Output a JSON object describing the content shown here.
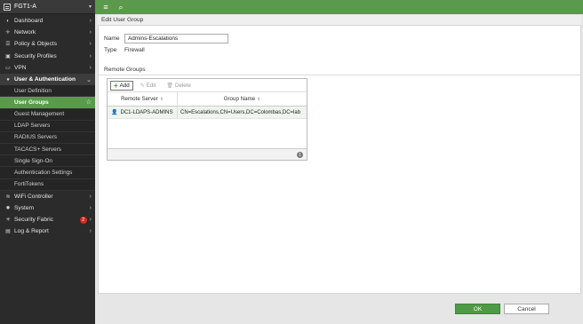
{
  "device": {
    "name": "FGT1-A"
  },
  "sidebar": {
    "items": [
      {
        "icon": "dashboard-icon",
        "glyph": "◐",
        "label": "Dashboard",
        "chevron": "›"
      },
      {
        "icon": "network-icon",
        "glyph": "✛",
        "label": "Network",
        "chevron": "›"
      },
      {
        "icon": "policy-icon",
        "glyph": "☰",
        "label": "Policy & Objects",
        "chevron": "›"
      },
      {
        "icon": "lock-icon",
        "glyph": "▣",
        "label": "Security Profiles",
        "chevron": "›"
      },
      {
        "icon": "vpn-icon",
        "glyph": "▭",
        "label": "VPN",
        "chevron": "›"
      },
      {
        "icon": "user-icon",
        "glyph": "●",
        "label": "User & Authentication",
        "chevron": "⌄"
      }
    ],
    "subitems": [
      {
        "label": "User Definition"
      },
      {
        "label": "User Groups"
      },
      {
        "label": "Guest Management"
      },
      {
        "label": "LDAP Servers"
      },
      {
        "label": "RADIUS Servers"
      },
      {
        "label": "TACACS+ Servers"
      },
      {
        "label": "Single Sign-On"
      },
      {
        "label": "Authentication Settings"
      },
      {
        "label": "FortiTokens"
      }
    ],
    "lower": [
      {
        "icon": "wifi-icon",
        "glyph": "≋",
        "label": "WiFi Controller",
        "chevron": "›"
      },
      {
        "icon": "gear-icon",
        "glyph": "✹",
        "label": "System",
        "chevron": "›"
      },
      {
        "icon": "fabric-icon",
        "glyph": "✳",
        "label": "Security Fabric",
        "badge": "2",
        "chevron": "›"
      },
      {
        "icon": "report-icon",
        "glyph": "▤",
        "label": "Log & Report",
        "chevron": "›"
      }
    ]
  },
  "topbar": {
    "menu_glyph": "≡",
    "search_glyph": "⌕"
  },
  "panel": {
    "title": "Edit User Group",
    "name_label": "Name",
    "name_value": "Admins-Escalations",
    "type_label": "Type",
    "type_value": "Firewall",
    "section_title": "Remote Groups"
  },
  "grid": {
    "add_label": "Add",
    "edit_label": "Edit",
    "delete_label": "Delete",
    "col_server": "Remote Server",
    "col_group": "Group Name",
    "rows": [
      {
        "server": "DC1-LDAPS-ADMINS",
        "group": "CN=Escalations,CN=Users,DC=Colombas,DC=lab"
      }
    ],
    "count": "1"
  },
  "footer": {
    "ok_label": "OK",
    "cancel_label": "Cancel"
  }
}
